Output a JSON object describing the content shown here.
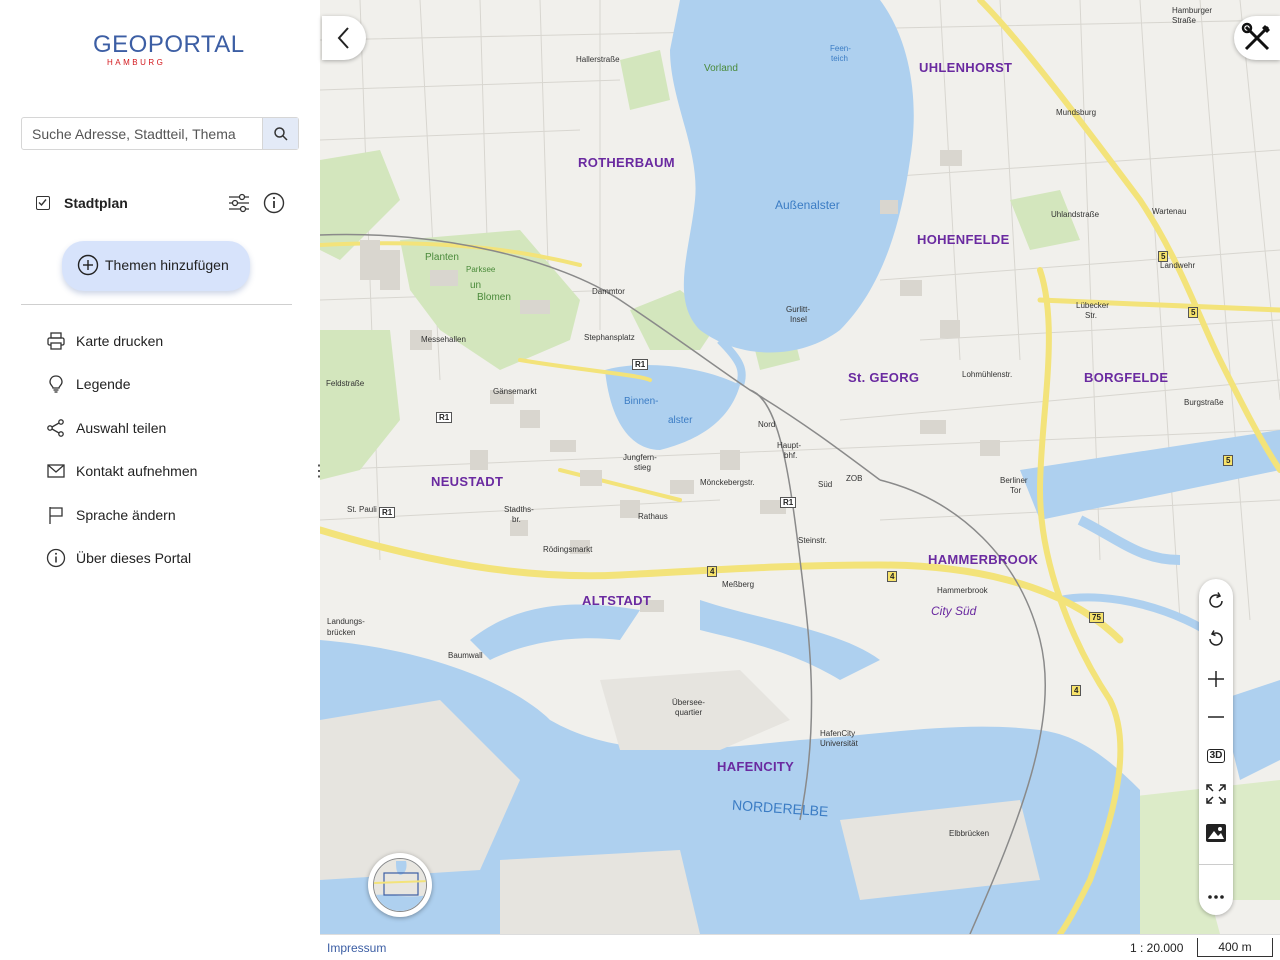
{
  "logo": {
    "main": "GEOPORTAL",
    "sub": "HAMBURG"
  },
  "search": {
    "placeholder": "Suche Adresse, Stadtteil, Thema"
  },
  "layer": {
    "label": "Stadtplan",
    "checked": true
  },
  "add_topics": {
    "label": "Themen hinzufügen"
  },
  "menu": [
    {
      "icon": "printer-icon",
      "label": "Karte drucken"
    },
    {
      "icon": "lightbulb-icon",
      "label": "Legende"
    },
    {
      "icon": "share-icon",
      "label": "Auswahl teilen"
    },
    {
      "icon": "mail-icon",
      "label": "Kontakt aufnehmen"
    },
    {
      "icon": "flag-icon",
      "label": "Sprache ändern"
    },
    {
      "icon": "info-icon",
      "label": "Über dieses Portal"
    }
  ],
  "map": {
    "districts": [
      "UHLENHORST",
      "ROTHERBAUM",
      "HOHENFELDE",
      "St. GEORG",
      "BORGFELDE",
      "NEUSTADT",
      "HAMMERBROOK",
      "ALTSTADT",
      "HAFENCITY"
    ],
    "water": [
      "Außenalster",
      "Binnen-",
      "alster",
      "NORDERELBE",
      "Feen-",
      "teich"
    ],
    "green": [
      "Planten",
      "un",
      "Blomen",
      "Parksee",
      "Gurlitt-",
      "Insel",
      "Vorland"
    ],
    "places": [
      "Hallerstraße",
      "Mundsburg",
      "Hamburger",
      "Straße",
      "Uhlandstraße",
      "Wartenau",
      "Landwehr",
      "Lübecker",
      "Str.",
      "Dammtor",
      "Stephansplatz",
      "Messehallen",
      "Lohmühlenstr.",
      "Burgstraße",
      "Gänsemarkt",
      "Feldstraße",
      "Nord",
      "Haupt-",
      "bhf.",
      "Süd",
      "ZOB",
      "Jungfern-",
      "stieg",
      "Mönckebergstr.",
      "Berliner",
      "Tor",
      "St. Pauli",
      "Stadths-",
      "br.",
      "Rathaus",
      "Steinstr.",
      "Rödingsmarkt",
      "Meßberg",
      "Hammerbrook",
      "City Süd",
      "Landungs-",
      "brücken",
      "Baumwall",
      "Übersee-",
      "quartier",
      "HafenCity",
      "Universität",
      "Elbbrücken"
    ],
    "roads": [
      "R1",
      "R1",
      "R1",
      "R1",
      "4",
      "4",
      "4",
      "5",
      "5",
      "5",
      "75"
    ]
  },
  "controls": {
    "rotate_cw": "rotate-clockwise-icon",
    "rotate_ccw": "rotate-counterclockwise-icon",
    "zoom_in": "plus-icon",
    "zoom_out": "minus-icon",
    "mode_3d": "3D",
    "fullscreen": "fullscreen-icon",
    "background": "image-icon",
    "more": "more-icon"
  },
  "footer": {
    "impressum": "Impressum",
    "scale": "1 : 20.000",
    "scale_bar": "400 m"
  }
}
